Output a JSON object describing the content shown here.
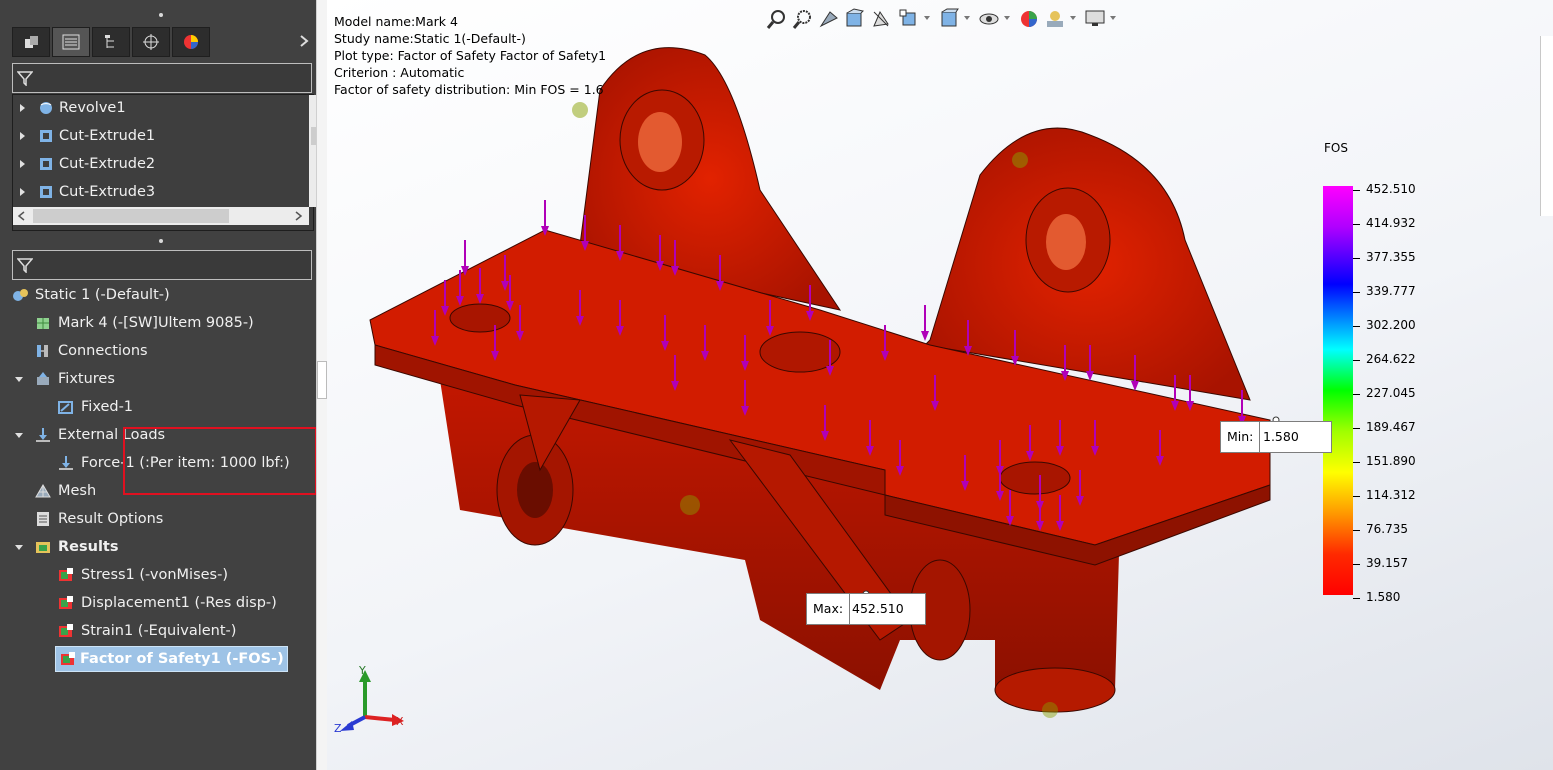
{
  "feature_tree": {
    "items": [
      {
        "label": "Revolve1",
        "icon": "revolve-icon"
      },
      {
        "label": "Cut-Extrude1",
        "icon": "cut-extrude-icon"
      },
      {
        "label": "Cut-Extrude2",
        "icon": "cut-extrude-icon"
      },
      {
        "label": "Cut-Extrude3",
        "icon": "cut-extrude-icon"
      }
    ]
  },
  "sim_tree": {
    "study": "Static 1 (-Default-)",
    "part": "Mark 4 (-[SW]Ultem 9085-)",
    "connections": "Connections",
    "fixtures": "Fixtures",
    "fixed": "Fixed-1",
    "external_loads": "External Loads",
    "force": "Force-1 (:Per item: 1000 lbf:)",
    "mesh": "Mesh",
    "result_options": "Result Options",
    "results": "Results",
    "stress": "Stress1 (-vonMises-)",
    "displacement": "Displacement1 (-Res disp-)",
    "strain": "Strain1 (-Equivalent-)",
    "fos": "Factor of Safety1 (-FOS-)"
  },
  "plot_info": {
    "model": "Model name:Mark 4",
    "study": "Study name:Static 1(-Default-)",
    "plot_type": "Plot type: Factor of Safety Factor of Safety1",
    "criterion": "Criterion : Automatic",
    "distribution": "Factor of safety distribution: Min FOS =  1.6"
  },
  "legend": {
    "title": "FOS",
    "ticks": [
      "452.510",
      "414.932",
      "377.355",
      "339.777",
      "302.200",
      "264.622",
      "227.045",
      "189.467",
      "151.890",
      "114.312",
      "76.735",
      "39.157",
      "1.580"
    ]
  },
  "callouts": {
    "min_key": "Min:",
    "min_value": "1.580",
    "max_key": "Max:",
    "max_value": "452.510"
  },
  "triad": {
    "x": "X",
    "y": "Y",
    "z": "Z"
  },
  "colors": {
    "highlight": "#9ec3e6",
    "model_red": "#d01a00",
    "load_arrows": "#b000b8",
    "annotation_box": "#e01020"
  }
}
